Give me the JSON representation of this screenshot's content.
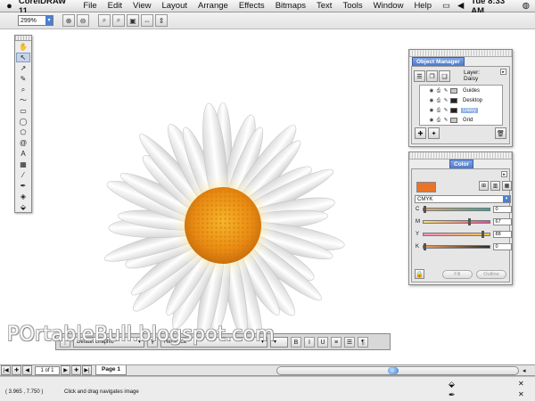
{
  "menubar": {
    "apple_icon": "apple-logo",
    "app_name": "CorelDRAW 11",
    "menus": [
      "File",
      "Edit",
      "View",
      "Layout",
      "Arrange",
      "Effects",
      "Bitmaps",
      "Text",
      "Tools",
      "Window",
      "Help"
    ],
    "clock": "Tue 8:33 AM"
  },
  "propbar": {
    "zoom_value": "299%"
  },
  "toolbox": {
    "tools": [
      "pick-tool",
      "shape-tool",
      "freehand-tool",
      "zoom-tool",
      "rectangle-tool",
      "ellipse-tool",
      "polygon-tool",
      "text-tool",
      "spiral-tool",
      "interactive-tool",
      "eyedropper-tool",
      "outline-tool",
      "fill-tool",
      "interactive-fill-tool",
      "pan-tool",
      "hand-tool"
    ]
  },
  "object_manager": {
    "title": "Object Manager",
    "layer_label": "Layer:",
    "layer_name": "Daisy",
    "layers": [
      {
        "name": "Guides",
        "swatch": "#c8c8c8",
        "active": false
      },
      {
        "name": "Desktop",
        "swatch": "#222222",
        "active": false
      },
      {
        "name": "Daisy",
        "swatch": "#222222",
        "active": true
      },
      {
        "name": "Grid",
        "swatch": "#c8c8c8",
        "active": false
      }
    ]
  },
  "color_docker": {
    "title": "Color",
    "current_color": "#e8742a",
    "model": "CMYK",
    "channels": [
      {
        "label": "C",
        "value": "0",
        "gradient": "linear-gradient(90deg,#f2a65a,#2aa7a0)",
        "pos": 0
      },
      {
        "label": "M",
        "value": "67",
        "gradient": "linear-gradient(90deg,#f5e16a,#e04a9a)",
        "pos": 67
      },
      {
        "label": "Y",
        "value": "88",
        "gradient": "linear-gradient(90deg,#f091c8,#f4c84c)",
        "pos": 88
      },
      {
        "label": "K",
        "value": "0",
        "gradient": "linear-gradient(90deg,#f2a05a,#2a2a2a)",
        "pos": 0
      }
    ],
    "fill_button": "Fill",
    "outline_button": "Outline"
  },
  "floatbar": {
    "style_dropdown": "Default Graphic",
    "font_dropdown": "Helvetica"
  },
  "watermark": "POrtableBull.blogspot.com",
  "pagenav": {
    "count": "1 of 1",
    "page_tab": "Page 1"
  },
  "status": {
    "coords": "( 3.965 , 7.750 )",
    "hint": "Click and drag navigates image"
  }
}
